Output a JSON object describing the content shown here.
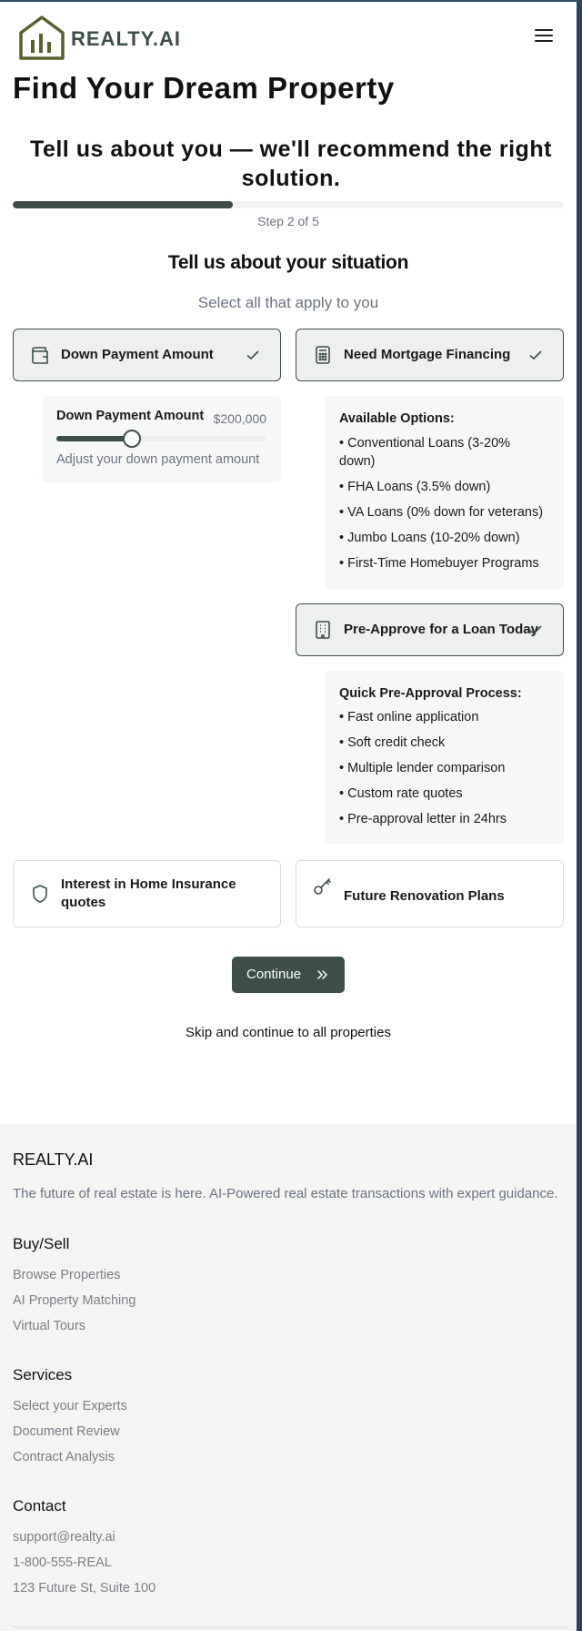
{
  "header": {
    "brand": "REALTY.AI",
    "logo_icon": "house-chart-icon",
    "menu_icon": "hamburger-menu-icon"
  },
  "page": {
    "title": "Find Your Dream Property",
    "subtitle": "Tell us about you — we'll recommend the right solution."
  },
  "progress": {
    "step_text": "Step 2 of 5",
    "fraction": 0.4
  },
  "section": {
    "title": "Tell us about your situation",
    "subtitle": "Select all that apply to you"
  },
  "options": {
    "down_payment": {
      "label": "Down Payment Amount",
      "icon": "wallet-icon",
      "selected": true
    },
    "mortgage": {
      "label": "Need Mortgage Financing",
      "icon": "calculator-icon",
      "selected": true
    },
    "preapprove": {
      "label": "Pre-Approve for a Loan Today",
      "icon": "building-icon",
      "selected": true
    },
    "insurance": {
      "label": "Interest in Home Insurance quotes",
      "icon": "shield-icon",
      "selected": false
    },
    "renovation": {
      "label": "Future Renovation Plans",
      "icon": "key-icon",
      "selected": false
    }
  },
  "slider": {
    "label": "Down Payment Amount",
    "value_text": "$200,000",
    "level": 0.36,
    "help": "Adjust your down payment amount"
  },
  "mortgage_panel": {
    "title": "Available Options:",
    "items": [
      "• Conventional Loans (3-20% down)",
      "• FHA Loans (3.5% down)",
      "• VA Loans (0% down for veterans)",
      "• Jumbo Loans (10-20% down)",
      "• First-Time Homebuyer Programs"
    ]
  },
  "preapproval_panel": {
    "title": "Quick Pre-Approval Process:",
    "items": [
      "• Fast online application",
      "• Soft credit check",
      "• Multiple lender comparison",
      "• Custom rate quotes",
      "• Pre-approval letter in 24hrs"
    ]
  },
  "actions": {
    "continue_label": "Continue",
    "skip_label": "Skip and continue to all properties"
  },
  "footer": {
    "brand": "REALTY.AI",
    "description": "The future of real estate is here. AI-Powered real estate transactions with expert guidance.",
    "sections": [
      {
        "heading": "Buy/Sell",
        "links": [
          "Browse Properties",
          "AI Property Matching",
          "Virtual Tours"
        ]
      },
      {
        "heading": "Services",
        "links": [
          "Select your Experts",
          "Document Review",
          "Contract Analysis"
        ]
      },
      {
        "heading": "Contact",
        "links": [
          "support@realty.ai",
          "1-800-555-REAL",
          "123 Future St, Suite 100"
        ]
      }
    ]
  },
  "colors": {
    "accent": "#3d4e48",
    "selected_bg": "#edf0ee",
    "muted_text": "#6b7280",
    "footer_bg": "#f4f4f3",
    "logo_olive": "#5a5f2e"
  }
}
